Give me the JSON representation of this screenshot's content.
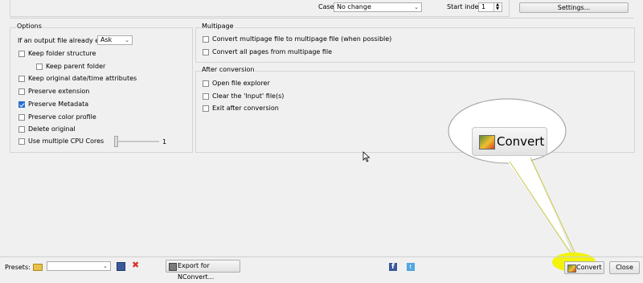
{
  "top": {
    "case_label": "Case",
    "case_value": "No change",
    "start_index_label": "Start index",
    "start_index_value": "1",
    "settings_label": "Settings..."
  },
  "options": {
    "title": "Options",
    "output_exists_label": "If an output file already exists",
    "output_exists_value": "Ask",
    "items": [
      {
        "label": "Keep folder structure",
        "checked": false
      },
      {
        "label": "Keep parent folder",
        "checked": false
      },
      {
        "label": "Keep original date/time attributes",
        "checked": false
      },
      {
        "label": "Preserve extension",
        "checked": false
      },
      {
        "label": "Preserve Metadata",
        "checked": true
      },
      {
        "label": "Preserve color profile",
        "checked": false
      },
      {
        "label": "Delete original",
        "checked": false
      },
      {
        "label": "Use multiple CPU Cores",
        "checked": false
      }
    ],
    "cpu_value": "1",
    "cpu_level": 0
  },
  "multipage": {
    "title": "Multipage",
    "items": [
      {
        "label": "Convert multipage file to multipage file (when possible)",
        "checked": false
      },
      {
        "label": "Convert all pages from multipage file",
        "checked": false
      }
    ]
  },
  "after": {
    "title": "After conversion",
    "items": [
      {
        "label": "Open file explorer",
        "checked": false
      },
      {
        "label": "Clear the 'Input' file(s)",
        "checked": false
      },
      {
        "label": "Exit after conversion",
        "checked": false
      }
    ]
  },
  "callout": {
    "label": "Convert"
  },
  "bottom": {
    "presets_label": "Presets:",
    "presets_value": "",
    "export_label": "Export for NConvert...",
    "convert_label": "Convert",
    "close_label": "Close"
  },
  "colors": {
    "highlight": "#f2f200",
    "facebook": "#3b5998",
    "twitter": "#4fa6e0",
    "delete_x": "#d9312b"
  }
}
